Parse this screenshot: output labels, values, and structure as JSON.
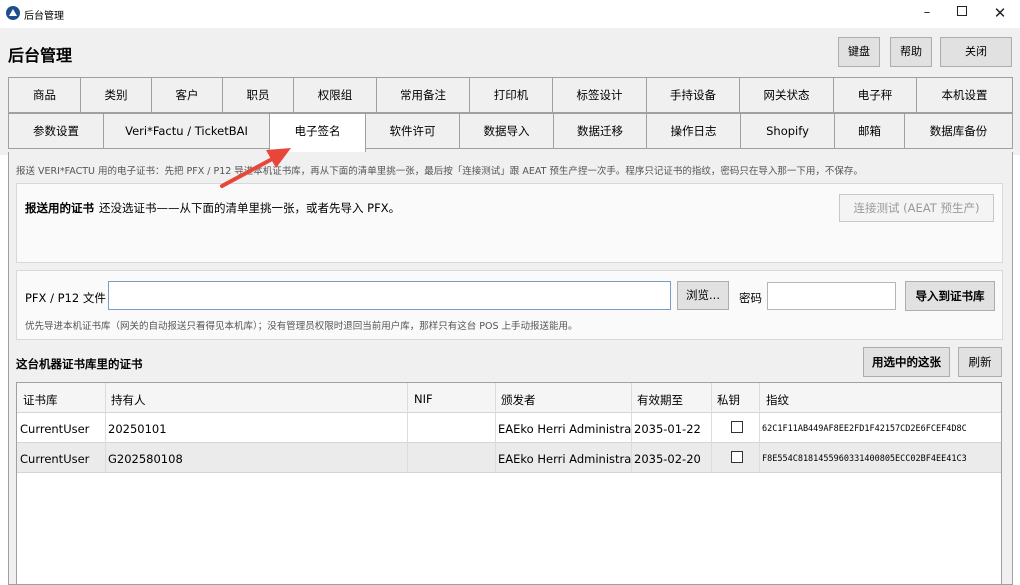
{
  "window": {
    "title": "后台管理",
    "controls": {
      "minimize": "–",
      "close": "✕"
    }
  },
  "header": {
    "title": "后台管理",
    "buttons": {
      "keyboard": "键盘",
      "help": "帮助",
      "close": "关闭"
    }
  },
  "tabs": {
    "row1": [
      "商品",
      "类别",
      "客户",
      "职员",
      "权限组",
      "常用备注",
      "打印机",
      "标签设计",
      "手持设备",
      "网关状态",
      "电子秤",
      "本机设置"
    ],
    "row2": [
      "参数设置",
      "Veri*Factu / TicketBAI",
      "电子签名",
      "软件许可",
      "数据导入",
      "数据迁移",
      "操作日志",
      "Shopify",
      "邮箱",
      "数据库备份"
    ],
    "active": "电子签名"
  },
  "hint": "报送 VERI*FACTU 用的电子证书：先把 PFX / P12 导进本机证书库，再从下面的清单里挑一张，最后按「连接测试」跟 AEAT 预生产捏一次手。程序只记证书的指纹，密码只在导入那一下用，不保存。",
  "current_cert": {
    "label": "报送用的证书",
    "value": "还没选证书——从下面的清单里挑一张，或者先导入 PFX。",
    "test_button": "连接测试 (AEAT 预生产)"
  },
  "import": {
    "file_label": "PFX / P12 文件",
    "file_value": "",
    "browse_button": "浏览...",
    "password_label": "密码",
    "password_value": "",
    "import_button": "导入到证书库",
    "note": "优先导进本机证书库（网关的自动报送只看得见本机库）；没有管理员权限时退回当前用户库，那样只有这台 POS 上手动报送能用。"
  },
  "cert_list": {
    "title": "这台机器证书库里的证书",
    "use_button": "用选中的这张",
    "refresh_button": "刷新",
    "columns": [
      "证书库",
      "持有人",
      "NIF",
      "颁发者",
      "有效期至",
      "私钥",
      "指纹"
    ],
    "rows": [
      {
        "store": "CurrentUser",
        "holder": "20250101",
        "nif": "",
        "issuer": "EAEko Herri Administrazio",
        "expires": "2035-01-22",
        "private_key": false,
        "thumbprint": "62C1F11AB449AF8EE2FD1F42157CD2E6FCEF4D8C"
      },
      {
        "store": "CurrentUser",
        "holder": "G202580108",
        "nif": "",
        "issuer": "EAEko Herri Administrazio",
        "expires": "2035-02-20",
        "private_key": false,
        "thumbprint": "F8E554C8181455960331400805ECC02BF4EE41C3"
      }
    ]
  },
  "colors": {
    "arrow": "#e8463a",
    "input_border": "#7a9cc6",
    "background": "#f0f0f0"
  }
}
